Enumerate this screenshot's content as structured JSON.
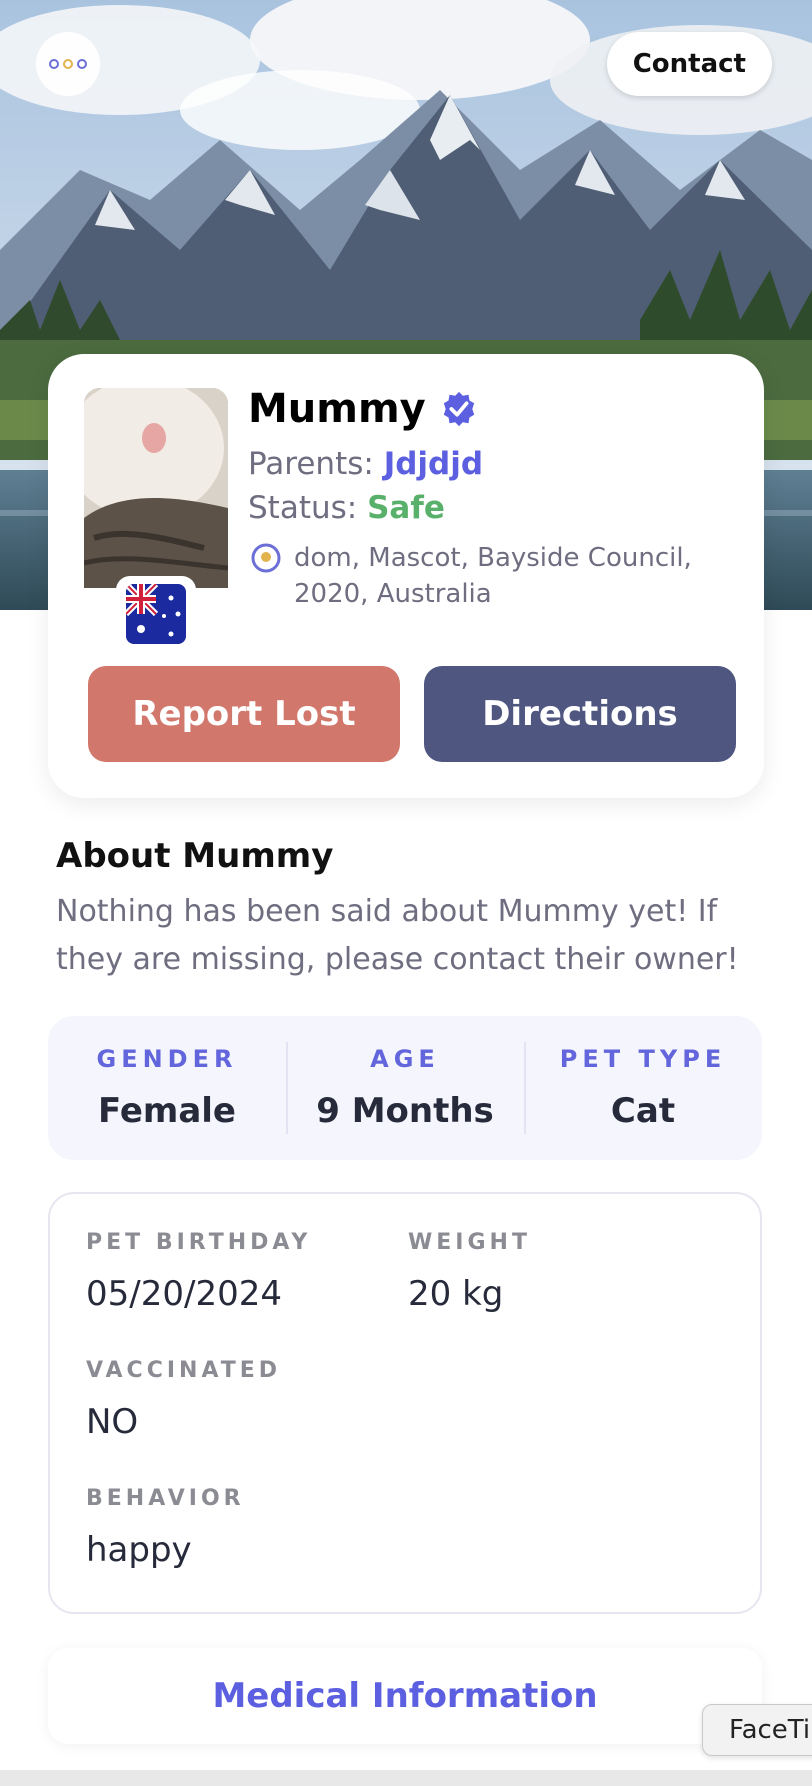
{
  "header": {
    "menu_icon": "ellipsis-icon",
    "contact_label": "Contact"
  },
  "profile": {
    "name": "Mummy",
    "verified_icon": "verified-check-icon",
    "parents_label": "Parents:",
    "parents_value": "Jdjdjd",
    "status_label": "Status:",
    "status_value": "Safe",
    "location_icon": "location-pin-icon",
    "location": "dom, Mascot, Bayside Council, 2020, Australia",
    "flag_icon": "australia-flag-icon",
    "report_lost_label": "Report Lost",
    "directions_label": "Directions"
  },
  "about": {
    "title": "About Mummy",
    "text": "Nothing has been said about Mummy yet! If they are missing, please contact their owner!"
  },
  "stats": [
    {
      "label": "GENDER",
      "value": "Female"
    },
    {
      "label": "AGE",
      "value": "9 Months"
    },
    {
      "label": "PET TYPE",
      "value": "Cat"
    }
  ],
  "details": {
    "birthday_label": "PET BIRTHDAY",
    "birthday_value": "05/20/2024",
    "weight_label": "WEIGHT",
    "weight_value": "20 kg",
    "vaccinated_label": "VACCINATED",
    "vaccinated_value": "NO",
    "behavior_label": "BEHAVIOR",
    "behavior_value": "happy"
  },
  "medical_label": "Medical Information",
  "facetime_tooltip": "FaceTi",
  "colors": {
    "accent": "#5b5fe0",
    "report_lost": "#d2776b",
    "directions": "#4f5680",
    "status_safe": "#58b06a"
  }
}
